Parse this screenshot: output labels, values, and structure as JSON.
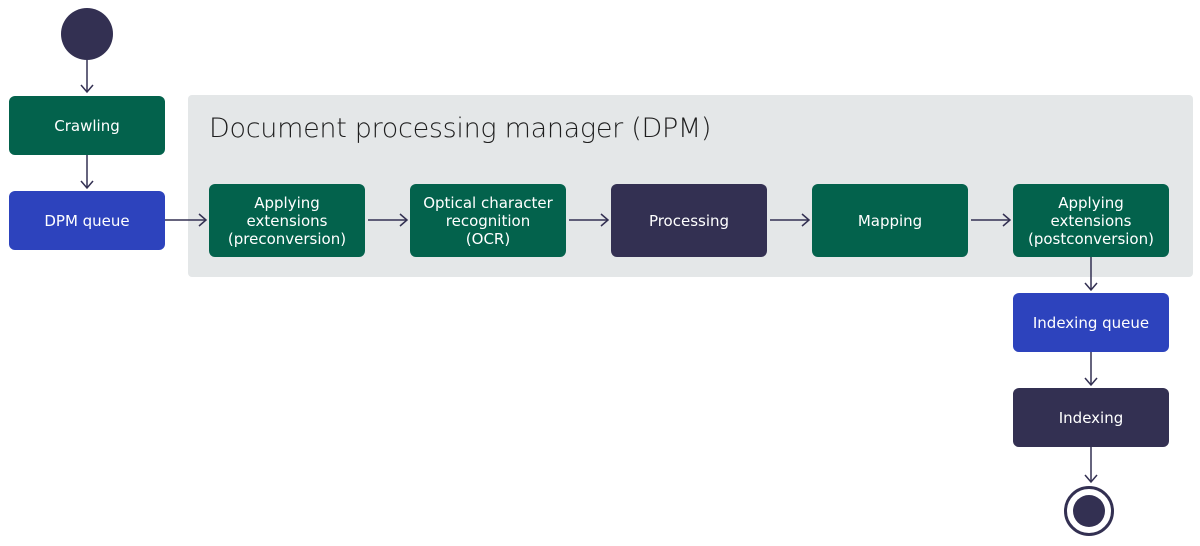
{
  "diagram": {
    "group": {
      "title": "Document processing manager (DPM)"
    },
    "nodes": {
      "crawling": "Crawling",
      "dpm_queue": "DPM queue",
      "pre_ext": "Applying\nextensions\n(preconversion)",
      "ocr": "Optical character\nrecognition\n(OCR)",
      "processing": "Processing",
      "mapping": "Mapping",
      "post_ext": "Applying\nextensions\n(postconversion)",
      "indexing_queue": "Indexing queue",
      "indexing": "Indexing"
    },
    "colors": {
      "green": "#03624c",
      "blue": "#2d43bd",
      "navy": "#333052",
      "group_bg": "#e4e7e8"
    }
  }
}
